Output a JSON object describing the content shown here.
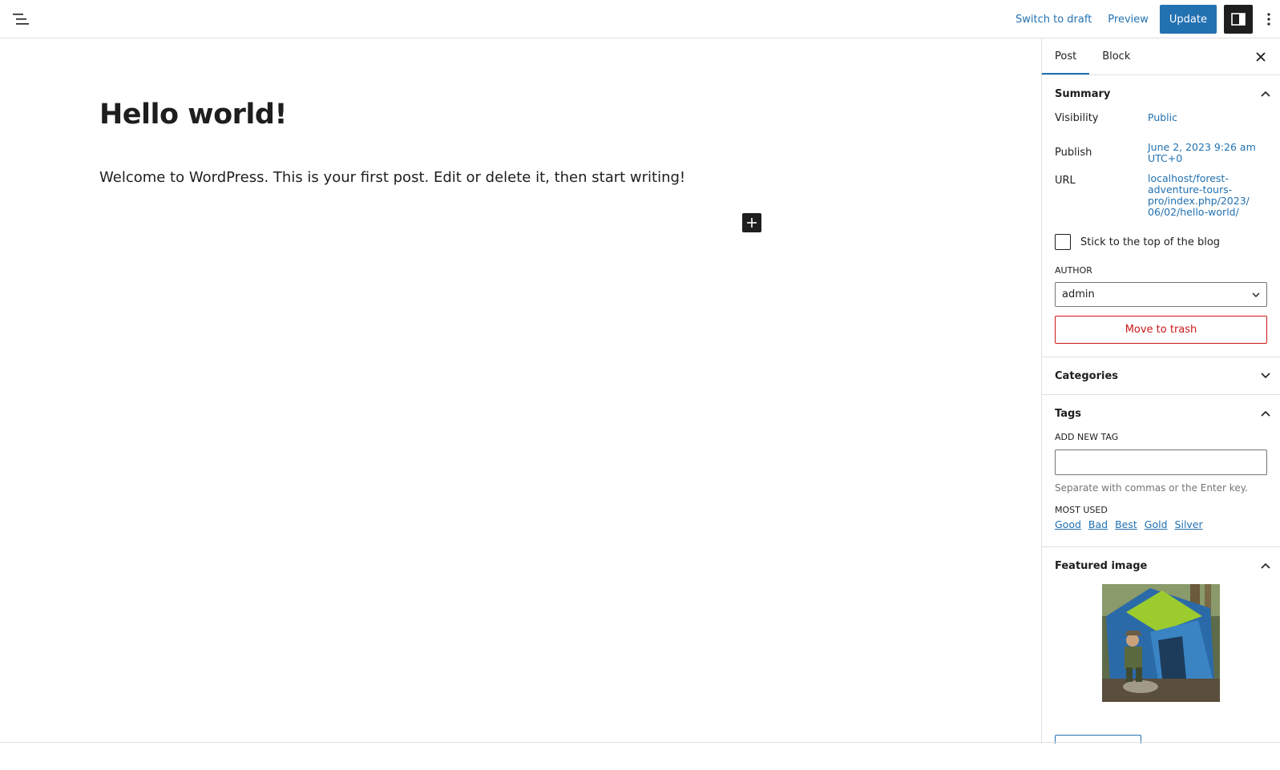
{
  "topbar": {
    "switch_to_draft": "Switch to draft",
    "preview": "Preview",
    "update": "Update"
  },
  "editor": {
    "title": "Hello world!",
    "body": "Welcome to WordPress. This is your first post. Edit or delete it, then start writing!"
  },
  "sidebar": {
    "tabs": [
      {
        "label": "Post"
      },
      {
        "label": "Block"
      }
    ],
    "summary": {
      "heading": "Summary",
      "visibility_label": "Visibility",
      "visibility_value": "Public",
      "publish_label": "Publish",
      "publish_line1": "June 2, 2023 9:26 am",
      "publish_line2": "UTC+0",
      "url_label": "URL",
      "url_lines": [
        "localhost/forest-",
        "adventure-tours-",
        "pro/index.php/2023/",
        "06/02/hello-world/"
      ],
      "sticky_label": "Stick to the top of the blog",
      "author_label": "AUTHOR",
      "author_value": "admin",
      "trash_label": "Move to trash"
    },
    "categories": {
      "heading": "Categories"
    },
    "tags": {
      "heading": "Tags",
      "add_label": "ADD NEW TAG",
      "help": "Separate with commas or the Enter key.",
      "most_used_label": "MOST USED",
      "most_used": [
        "Good",
        "Bad",
        "Best",
        "Gold",
        "Silver"
      ]
    },
    "featured": {
      "heading": "Featured image"
    }
  },
  "colors": {
    "accent": "#2271b1",
    "danger": "#cc1818",
    "dark": "#1e1e1e"
  }
}
